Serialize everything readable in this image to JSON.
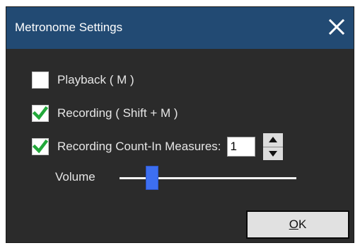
{
  "window": {
    "title": "Metronome Settings",
    "close_icon": "close-icon"
  },
  "options": {
    "playback": {
      "label": "Playback ( M )",
      "checked": false
    },
    "recording": {
      "label": "Recording ( Shift + M )",
      "checked": true
    },
    "count_in": {
      "label": "Recording Count-In Measures:",
      "checked": true,
      "value": "1"
    }
  },
  "volume": {
    "label": "Volume",
    "level": 0.16
  },
  "buttons": {
    "ok_mnemonic": "O",
    "ok_rest": "K"
  },
  "colors": {
    "titlebar": "#224a73",
    "dialog_bg": "#2b2b2b",
    "check": "#22a83a",
    "slider_thumb": "#3d6ff0"
  }
}
